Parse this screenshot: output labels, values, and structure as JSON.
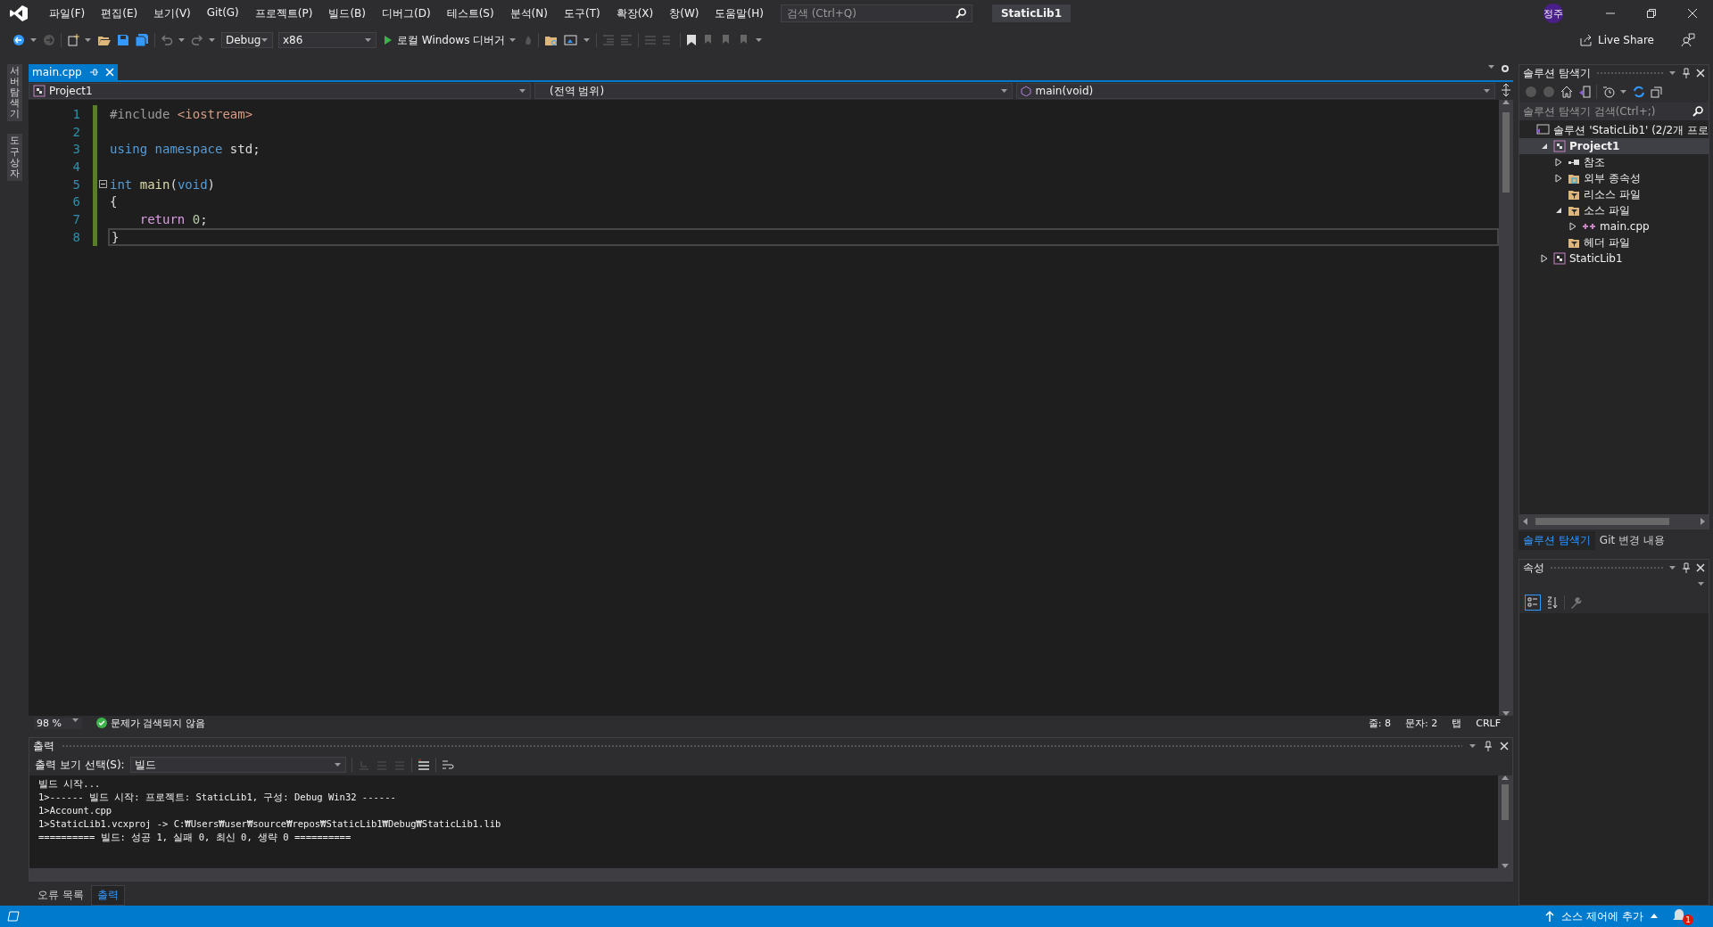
{
  "menu": [
    "파일(F)",
    "편집(E)",
    "보기(V)",
    "Git(G)",
    "프로젝트(P)",
    "빌드(B)",
    "디버그(D)",
    "테스트(S)",
    "분석(N)",
    "도구(T)",
    "확장(X)",
    "창(W)",
    "도움말(H)"
  ],
  "search": {
    "placeholder": "검색 (Ctrl+Q)"
  },
  "window": {
    "title": "StaticLib1"
  },
  "user": {
    "initials": "정주"
  },
  "live_share": "Live Share",
  "toolbar": {
    "configuration": "Debug",
    "platform": "x86",
    "run_label": "로컬 Windows 디버거"
  },
  "side_tabs": [
    "서버 탐색기",
    "도구 상자"
  ],
  "editor": {
    "tabs": [
      {
        "label": "main.cpp",
        "selected": true
      }
    ],
    "nav": {
      "project": "Project1",
      "scope": "(전역 범위)",
      "member": "main(void)"
    },
    "lines": [
      {
        "number": "1",
        "current": false,
        "fold": false,
        "tokens": [
          {
            "text": "#include ",
            "kind": "preprocessor"
          },
          {
            "text": "<iostream>",
            "kind": "header"
          }
        ]
      },
      {
        "number": "2",
        "current": false,
        "fold": false
      },
      {
        "number": "3",
        "current": false,
        "fold": false,
        "tokens": [
          {
            "text": "using namespace ",
            "kind": "keyword"
          },
          {
            "text": "std;",
            "kind": "plain"
          }
        ]
      },
      {
        "number": "4",
        "current": false,
        "fold": false
      },
      {
        "number": "5",
        "current": false,
        "fold": true,
        "tokens": [
          {
            "text": "int ",
            "kind": "keyword"
          },
          {
            "text": "main",
            "kind": "function"
          },
          {
            "text": "(",
            "kind": "plain"
          },
          {
            "text": "void",
            "kind": "keyword"
          },
          {
            "text": ")",
            "kind": "plain"
          }
        ]
      },
      {
        "number": "6",
        "current": false,
        "fold": false,
        "tokens": [
          {
            "text": "{",
            "kind": "plain"
          }
        ]
      },
      {
        "number": "7",
        "current": false,
        "fold": false,
        "tokens": [
          {
            "text": "    return ",
            "kind": "control"
          },
          {
            "text": "0",
            "kind": "number"
          },
          {
            "text": ";",
            "kind": "plain"
          }
        ]
      },
      {
        "number": "8",
        "current": true,
        "fold": false,
        "tokens": [
          {
            "text": "}",
            "kind": "plain"
          }
        ]
      }
    ],
    "status": {
      "zoom": "98 %",
      "issues": "문제가 검색되지 않음",
      "line": "줄: 8",
      "column": "문자: 2",
      "indent": "탭",
      "line_ending": "CRLF"
    }
  },
  "output": {
    "title": "출력",
    "source_label": "출력 보기 선택(S):",
    "source": "빌드",
    "lines": [
      "빌드 시작...",
      "1>------ 빌드 시작: 프로젝트: StaticLib1, 구성: Debug Win32 ------",
      "1>Account.cpp",
      "1>StaticLib1.vcxproj -> C:₩Users₩user₩source₩repos₩StaticLib1₩Debug₩StaticLib1.lib",
      "========== 빌드: 성공 1, 실패 0, 최신 0, 생략 0 =========="
    ]
  },
  "bottom_tabs": [
    {
      "label": "오류 목록",
      "selected": false
    },
    {
      "label": "출력",
      "selected": true
    }
  ],
  "solution_explorer": {
    "title": "솔루션 탐색기",
    "search": {
      "placeholder": "솔루션 탐색기 검색(Ctrl+;)"
    },
    "tree": [
      {
        "label": "솔루션 'StaticLib1' (2/2개 프로",
        "kind": "solution",
        "selected": false,
        "startup": false,
        "children": [
          {
            "label": "Project1",
            "kind": "project",
            "expanded": true,
            "selected": true,
            "startup": true,
            "children": [
              {
                "label": "참조",
                "kind": "references",
                "expanded": false,
                "selected": false,
                "startup": false
              },
              {
                "label": "외부 종속성",
                "kind": "external",
                "expanded": false,
                "selected": false,
                "startup": false
              },
              {
                "label": "리소스 파일",
                "kind": "filter",
                "selected": false,
                "startup": false
              },
              {
                "label": "소스 파일",
                "kind": "filter",
                "expanded": true,
                "selected": false,
                "startup": false,
                "children": [
                  {
                    "label": "main.cpp",
                    "kind": "cpp",
                    "expanded": false,
                    "selected": false,
                    "startup": false
                  }
                ]
              },
              {
                "label": "헤더 파일",
                "kind": "filter",
                "selected": false,
                "startup": false
              }
            ]
          },
          {
            "label": "StaticLib1",
            "kind": "project",
            "expanded": false,
            "selected": false,
            "startup": false
          }
        ]
      }
    ],
    "tabs": [
      {
        "label": "솔루션 탐색기",
        "selected": true
      },
      {
        "label": "Git 변경 내용",
        "selected": false
      }
    ]
  },
  "properties": {
    "title": "속성"
  },
  "status_bar": {
    "source_control": "소스 제어에 추가",
    "notifications": "1"
  }
}
